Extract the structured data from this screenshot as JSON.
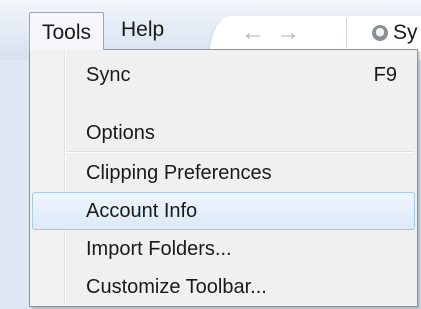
{
  "menubar": {
    "items": [
      {
        "label": "Tools"
      },
      {
        "label": "Help"
      }
    ]
  },
  "toolbar": {
    "back_glyph": "←",
    "forward_glyph": "→",
    "sync_label": "Sy",
    "icons": [
      "back-arrow-icon",
      "forward-arrow-icon",
      "sync-icon"
    ]
  },
  "tools_menu": {
    "items": [
      {
        "label": "Sync",
        "shortcut": "F9"
      },
      {
        "label": "Options"
      },
      {
        "label": "Clipping Preferences"
      },
      {
        "label": "Account Info",
        "state": "hovered"
      },
      {
        "label": "Import Folders..."
      },
      {
        "label": "Customize Toolbar..."
      }
    ]
  },
  "colors": {
    "menu_background": "#f0f0f0",
    "highlight_fill": "#dce9f8",
    "highlight_border": "#a8c8ec",
    "menubar_background": "#e2eaf4"
  }
}
